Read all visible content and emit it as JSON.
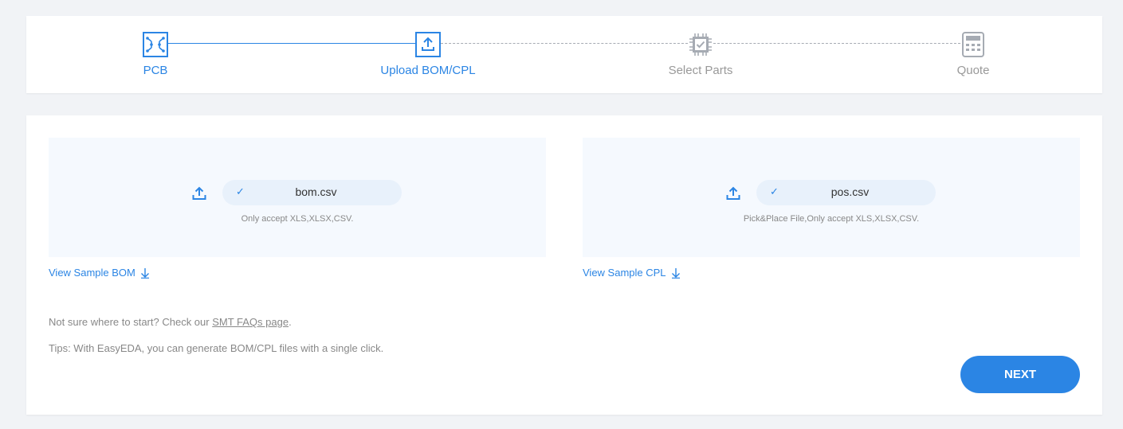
{
  "colors": {
    "accent": "#2b85e4",
    "inactive": "#a6abb3",
    "background": "#f1f3f6",
    "dropzone": "#f5f9fe"
  },
  "stepper": {
    "steps": [
      {
        "label": "PCB",
        "icon": "pcb-icon",
        "state": "complete"
      },
      {
        "label": "Upload BOM/CPL",
        "icon": "upload-icon",
        "state": "current"
      },
      {
        "label": "Select Parts",
        "icon": "chip-icon",
        "state": "pending"
      },
      {
        "label": "Quote",
        "icon": "calculator-icon",
        "state": "pending"
      }
    ]
  },
  "bom": {
    "file_name": "bom.csv",
    "note": "Only accept XLS,XLSX,CSV.",
    "sample_link": "View Sample BOM"
  },
  "cpl": {
    "file_name": "pos.csv",
    "note": "Pick&Place File,Only accept XLS,XLSX,CSV.",
    "sample_link": "View Sample CPL"
  },
  "help": {
    "prefix": "Not sure where to start? Check our ",
    "link": "SMT FAQs page",
    "suffix": "."
  },
  "tips": "Tips: With EasyEDA, you can generate BOM/CPL files with a single click.",
  "next_label": "NEXT"
}
